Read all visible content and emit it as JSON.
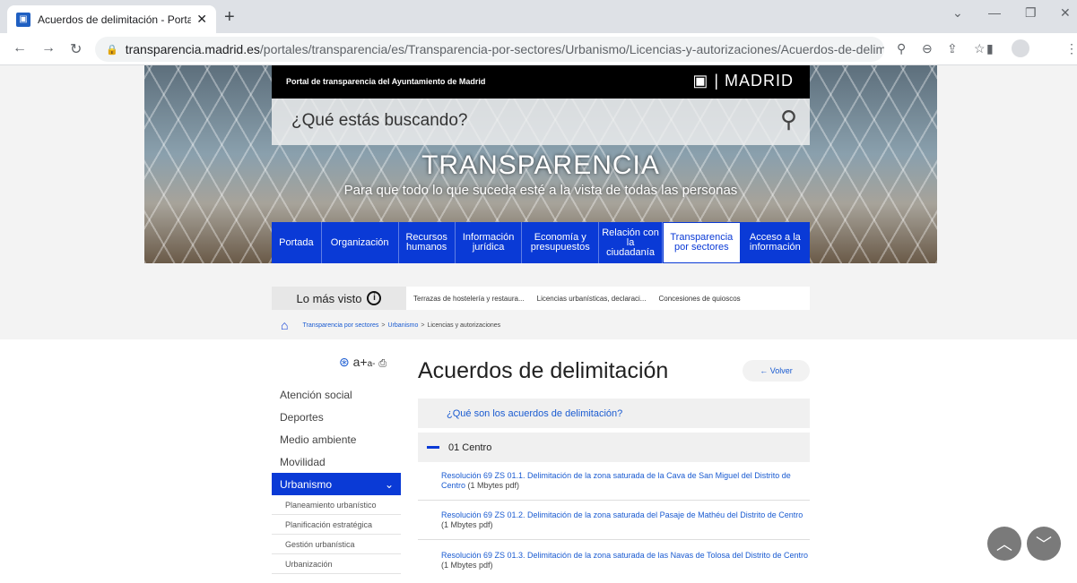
{
  "browser": {
    "tab_title": "Acuerdos de delimitación - Porta",
    "tab_icon": "madrid-favicon-icon",
    "url_host": "transparencia.madrid.es",
    "url_path": "/portales/transparencia/es/Transparencia-por-sectores/Urbanismo/Licencias-y-autorizaciones/Acuerdos-de-delimitacio..."
  },
  "header": {
    "portal_title": "Portal de transparencia del Ayuntamiento de Madrid",
    "logo_text": "MADRID",
    "search_placeholder": "¿Qué estás buscando?",
    "headline": "TRANSPARENCIA",
    "tagline": "Para que todo lo que suceda esté a la vista de todas las personas"
  },
  "nav": {
    "items": [
      {
        "label": "Portada"
      },
      {
        "label": "Organización"
      },
      {
        "label": "Recursos humanos"
      },
      {
        "label": "Información jurídica"
      },
      {
        "label": "Economía y presupuestos"
      },
      {
        "label": "Relación con la ciudadanía"
      },
      {
        "label": "Transparencia por sectores"
      },
      {
        "label": "Acceso a la información"
      }
    ],
    "active_index": 6
  },
  "most_seen": {
    "label": "Lo más visto",
    "links": [
      "Terrazas de hostelería y restaura...",
      "Licencias urbanísticas, declaraci...",
      "Concesiones de quioscos"
    ]
  },
  "breadcrumb": {
    "items": [
      "Transparencia por sectores",
      "Urbanismo"
    ],
    "current": "Licencias y autorizaciones"
  },
  "sidebar": {
    "items": [
      "Atención social",
      "Deportes",
      "Medio ambiente",
      "Movilidad"
    ],
    "active": "Urbanismo",
    "sub_items": [
      "Planeamiento urbanístico",
      "Planificación estratégica",
      "Gestión urbanística",
      "Urbanización"
    ]
  },
  "main": {
    "title": "Acuerdos de delimitación",
    "back_label": "← Volver",
    "faq_label": "¿Qué son los acuerdos de delimitación?",
    "section_label": "01 Centro",
    "documents": [
      {
        "text": "Resolución 69 ZS 01.1. Delimitación de la zona saturada de la Cava de San Miguel del Distrito de Centro",
        "size": "(1 Mbytes pdf)"
      },
      {
        "text": "Resolución 69 ZS 01.2. Delimitación de la zona saturada del Pasaje de Mathéu del Distrito de Centro",
        "size": "(1 Mbytes pdf)"
      },
      {
        "text": "Resolución 69 ZS 01.3. Delimitación de la zona saturada de las Navas de Tolosa del Distrito de Centro",
        "size": "(1 Mbytes pdf)"
      }
    ]
  },
  "colors": {
    "primary_blue": "#0a3ad6",
    "link_blue": "#1a5bd1"
  }
}
